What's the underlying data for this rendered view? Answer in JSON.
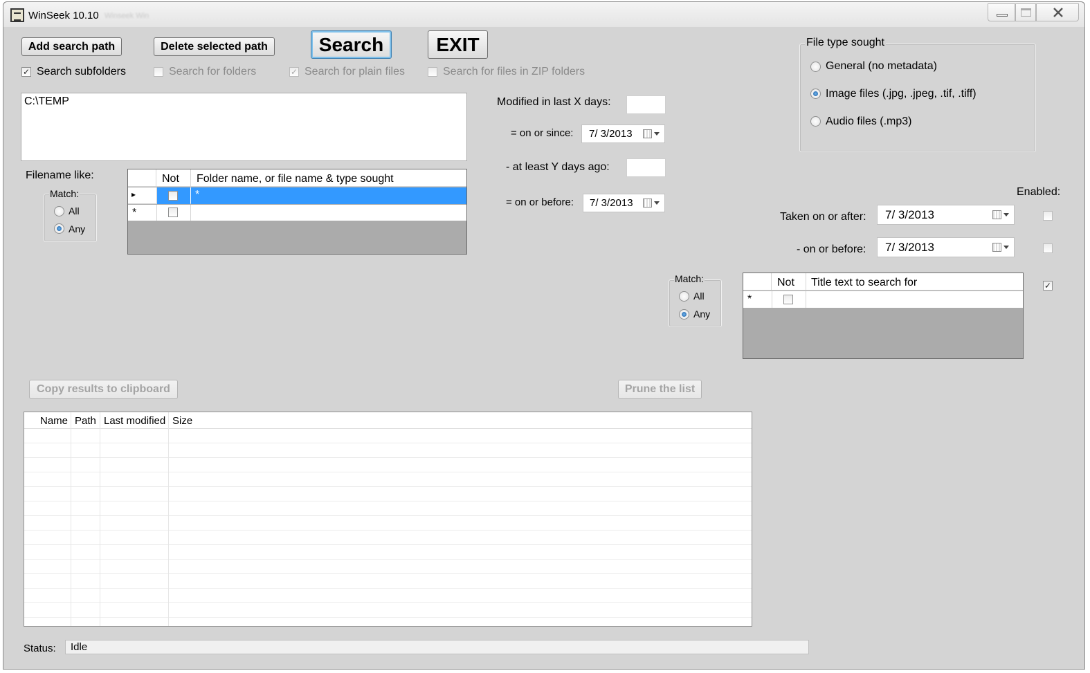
{
  "window": {
    "title": "WinSeek  10.10",
    "title_suffix": "Winseek Win"
  },
  "toolbar": {
    "add_path": "Add search path",
    "delete_path": "Delete selected path",
    "search": "Search",
    "exit": "EXIT"
  },
  "options": {
    "subfolders": {
      "label": "Search subfolders",
      "checked": true
    },
    "folders": {
      "label": "Search for folders",
      "checked": false
    },
    "plain_files": {
      "label": "Search for plain files",
      "checked": true
    },
    "zip": {
      "label": "Search for files in ZIP folders",
      "checked": false
    }
  },
  "paths": {
    "value": "C:\\TEMP"
  },
  "filename": {
    "label": "Filename like:",
    "match_label": "Match:",
    "match_all": "All",
    "match_any": "Any",
    "selected": "Any",
    "col_not": "Not",
    "col_name": "Folder name, or file name & type sought",
    "rows": [
      {
        "marker": "▸",
        "not": false,
        "value": "*"
      },
      {
        "marker": "*",
        "not": false,
        "value": ""
      }
    ]
  },
  "dates": {
    "modified_label": "Modified in last X days:",
    "on_or_since_label": "=  on or since:",
    "on_or_since_value": "7/  3/2013",
    "at_least_label": "- at least Y days ago:",
    "on_or_before_label": "=  on or before:",
    "on_or_before_value": "7/  3/2013"
  },
  "filetype": {
    "group_label": "File type sought",
    "options": [
      "General (no metadata)",
      "Image files (.jpg, .jpeg, .tif, .tiff)",
      "Audio files (.mp3)"
    ],
    "selected": "Image files (.jpg, .jpeg, .tif, .tiff)"
  },
  "metadata": {
    "enabled_label": "Enabled:",
    "taken_after_label": "Taken on or after:",
    "taken_after_value": "7/  3/2013",
    "taken_after_enabled": false,
    "taken_before_label": "- on or before:",
    "taken_before_value": "7/  3/2013",
    "taken_before_enabled": false,
    "title_enabled": true,
    "match_label": "Match:",
    "match_all": "All",
    "match_any": "Any",
    "selected": "Any",
    "col_not": "Not",
    "col_title": "Title text to search for",
    "new_row_marker": "*"
  },
  "results": {
    "copy_button": "Copy results to clipboard",
    "prune_button": "Prune the list",
    "columns": [
      "Name",
      "Path",
      "Last modified",
      "Size"
    ]
  },
  "status": {
    "label": "Status:",
    "value": "Idle"
  },
  "colors": {
    "selection": "#3399ff",
    "window_bg": "#d4d4d4",
    "grid_bg": "#ababab"
  }
}
